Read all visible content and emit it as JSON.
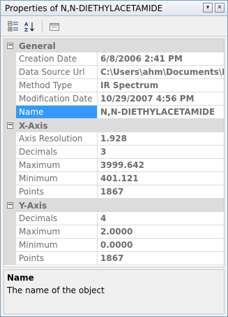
{
  "window": {
    "title": "Properties of N,N-DIETHYLACETAMIDE"
  },
  "titlebar_buttons": {
    "dropdown": "▾",
    "close": "✕"
  },
  "toolbar": {
    "items": [
      {
        "icon": "categorized-icon"
      },
      {
        "icon": "alphabetical-icon"
      },
      {
        "icon": "property-pages-icon"
      }
    ]
  },
  "grid": {
    "categories": [
      {
        "name": "General",
        "toggle": "−",
        "rows": [
          {
            "name": "Creation Date",
            "value": "6/8/2006 2:41 PM"
          },
          {
            "name": "Data Source Url",
            "value": "C:\\Users\\ahm\\Documents\\My H"
          },
          {
            "name": "Method Type",
            "value": "IR Spectrum"
          },
          {
            "name": "Modification Date",
            "value": "10/29/2007 4:56 PM"
          },
          {
            "name": "Name",
            "value": "N,N-DIETHYLACETAMIDE",
            "selected": true
          }
        ]
      },
      {
        "name": "X-Axis",
        "toggle": "−",
        "rows": [
          {
            "name": "Axis Resolution",
            "value": "1.928"
          },
          {
            "name": "Decimals",
            "value": "3"
          },
          {
            "name": "Maximum",
            "value": "3999.642"
          },
          {
            "name": "Minimum",
            "value": "401.121"
          },
          {
            "name": "Points",
            "value": "1867"
          }
        ]
      },
      {
        "name": "Y-Axis",
        "toggle": "−",
        "rows": [
          {
            "name": "Decimals",
            "value": "4"
          },
          {
            "name": "Maximum",
            "value": "2.0000"
          },
          {
            "name": "Minimum",
            "value": "0.0000"
          },
          {
            "name": "Points",
            "value": "1867"
          }
        ]
      }
    ]
  },
  "description": {
    "title": "Name",
    "text": "The name of the object"
  }
}
